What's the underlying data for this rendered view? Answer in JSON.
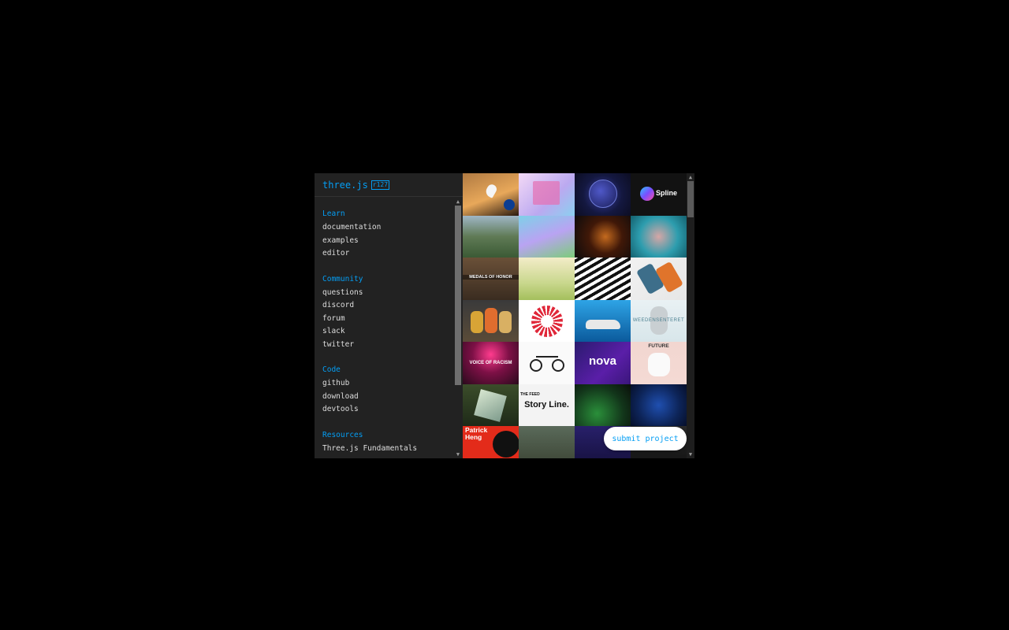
{
  "header": {
    "logo": "three.js",
    "version": "r127"
  },
  "sidebar": {
    "sections": [
      {
        "title": "Learn",
        "links": [
          "documentation",
          "examples",
          "editor"
        ]
      },
      {
        "title": "Community",
        "links": [
          "questions",
          "discord",
          "forum",
          "slack",
          "twitter"
        ]
      },
      {
        "title": "Code",
        "links": [
          "github",
          "download",
          "devtools"
        ]
      },
      {
        "title": "Resources",
        "links": [
          "Three.js Fundamentals"
        ]
      }
    ]
  },
  "tiles": {
    "spline": "Spline",
    "honor": "MEDALS OF HONOR",
    "weeden": "WEEDENSENTERET",
    "voice": "VOICE OF RACISM",
    "future": "FUTURE",
    "nova": "nova",
    "storyline": "Story Line.",
    "feed": "THE FEED",
    "patrick": "Patrick Heng"
  },
  "submit": {
    "label": "submit project"
  },
  "colors": {
    "accent": "#049ef4",
    "sidebar_bg": "#222222"
  }
}
